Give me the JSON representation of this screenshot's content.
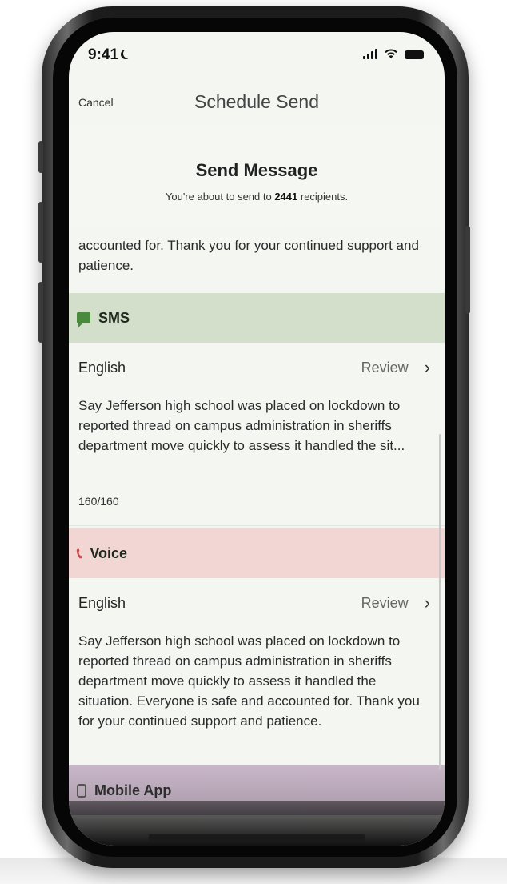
{
  "status_bar": {
    "time": "9:41"
  },
  "nav": {
    "cancel_label": "Cancel",
    "title": "Schedule Send"
  },
  "send": {
    "title": "Send Message",
    "subtitle_prefix": "You're about to send to ",
    "recipient_count": "2441",
    "subtitle_suffix": " recipients."
  },
  "top_message_tail": "accounted for. Thank you for your continued support and patience.",
  "sms": {
    "label": "SMS",
    "language": "English",
    "review_label": "Review",
    "message": "Say Jefferson high school was placed on lockdown to reported thread on campus administration in sheriffs department move quickly to assess it handled the sit...",
    "char_count": "160/160"
  },
  "voice": {
    "label": "Voice",
    "language": "English",
    "review_label": "Review",
    "message": "Say Jefferson high school was placed on lockdown to reported thread on campus administration in sheriffs department move quickly to assess it handled the situation. Everyone is safe and accounted for. Thank you for your continued support and patience."
  },
  "mobile_app": {
    "label": "Mobile App"
  },
  "colors": {
    "sms_header": "#d3dfca",
    "voice_header": "#f2d6d3",
    "sms_icon": "#4a8a3c",
    "voice_icon": "#c94a4a"
  }
}
